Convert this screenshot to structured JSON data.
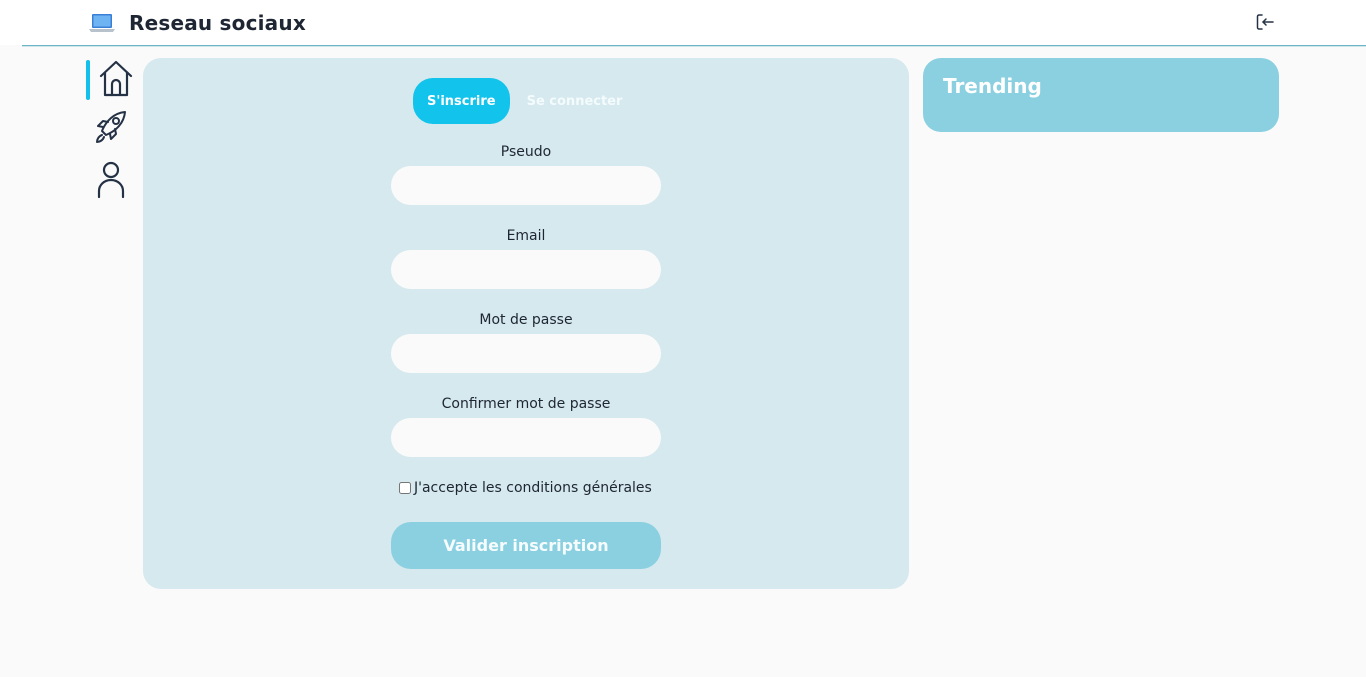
{
  "header": {
    "title": "Reseau sociaux",
    "brand_icon": "laptop-icon",
    "logout_icon": "logout-icon"
  },
  "nav": {
    "items": [
      {
        "icon": "home-icon",
        "active": true
      },
      {
        "icon": "rocket-icon",
        "active": false
      },
      {
        "icon": "user-icon",
        "active": false
      }
    ]
  },
  "auth": {
    "tabs": [
      {
        "label": "S'inscrire",
        "active": true
      },
      {
        "label": "Se connecter",
        "active": false
      }
    ],
    "fields": {
      "pseudo": {
        "label": "Pseudo",
        "value": ""
      },
      "email": {
        "label": "Email",
        "value": ""
      },
      "password": {
        "label": "Mot de passe",
        "value": ""
      },
      "confirm_password": {
        "label": "Confirmer mot de passe",
        "value": ""
      }
    },
    "terms_label": "J'accepte les conditions générales",
    "terms_checked": false,
    "submit_label": "Valider inscription"
  },
  "trending": {
    "title": "Trending"
  },
  "colors": {
    "accent": "#12c3ec",
    "card_bg": "#d5e9ee",
    "trending_bg": "#8ad0e0",
    "page_bg": "#fafafa"
  }
}
